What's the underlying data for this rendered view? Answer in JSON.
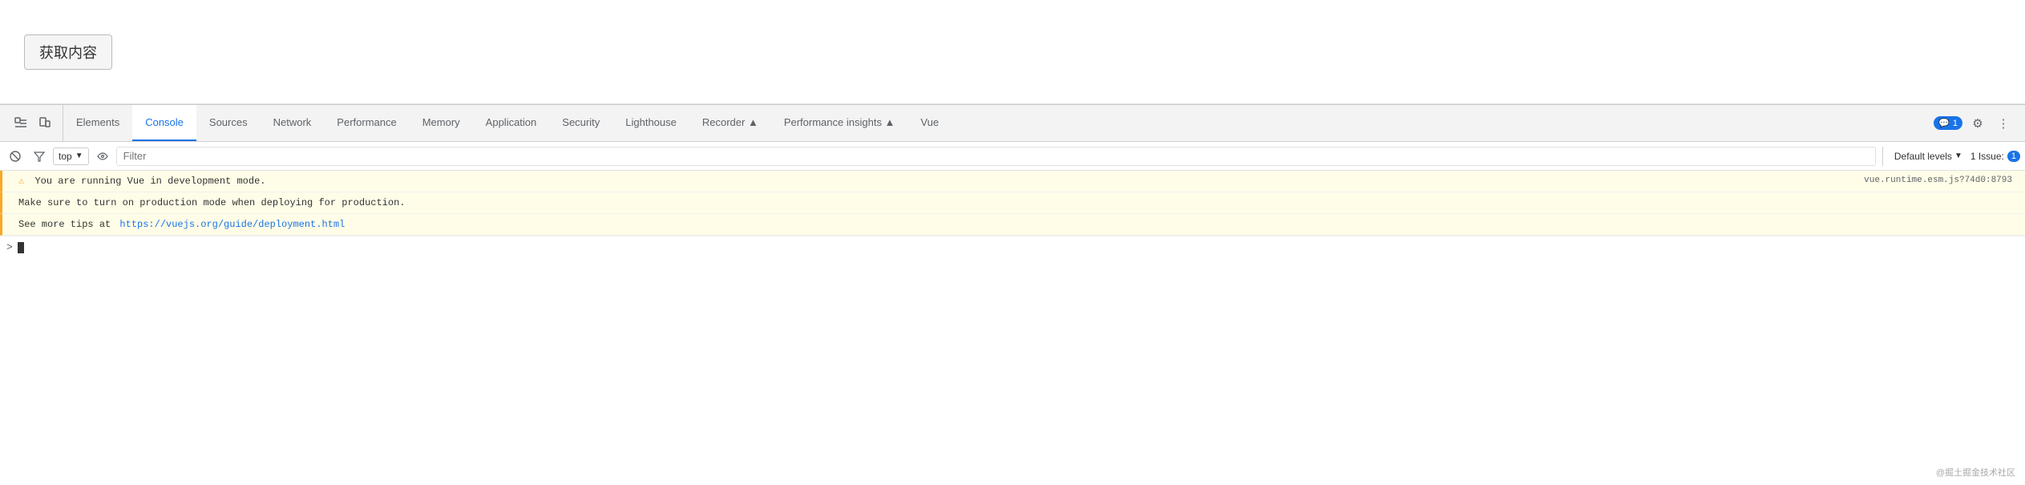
{
  "page": {
    "button_label": "获取内容"
  },
  "devtools": {
    "tabs": [
      {
        "id": "elements",
        "label": "Elements",
        "active": false
      },
      {
        "id": "console",
        "label": "Console",
        "active": true
      },
      {
        "id": "sources",
        "label": "Sources",
        "active": false
      },
      {
        "id": "network",
        "label": "Network",
        "active": false
      },
      {
        "id": "performance",
        "label": "Performance",
        "active": false
      },
      {
        "id": "memory",
        "label": "Memory",
        "active": false
      },
      {
        "id": "application",
        "label": "Application",
        "active": false
      },
      {
        "id": "security",
        "label": "Security",
        "active": false
      },
      {
        "id": "lighthouse",
        "label": "Lighthouse",
        "active": false
      },
      {
        "id": "recorder",
        "label": "Recorder ▲",
        "active": false
      },
      {
        "id": "performance-insights",
        "label": "Performance insights ▲",
        "active": false
      },
      {
        "id": "vue",
        "label": "Vue",
        "active": false
      }
    ],
    "right_badges": {
      "notification_icon": "💬",
      "notification_count": "1",
      "settings_icon": "⚙",
      "more_icon": "⋮"
    },
    "toolbar": {
      "clear_icon": "🚫",
      "top_label": "top",
      "eye_icon": "👁",
      "filter_placeholder": "Filter",
      "default_levels_label": "Default levels",
      "issues_label": "1 Issue:",
      "issues_count": "1"
    },
    "console_messages": [
      {
        "text": "You are running Vue in development mode.",
        "link": null,
        "link_text": null,
        "file_ref": "vue.runtime.esm.js?74d0:8793",
        "type": "warning"
      },
      {
        "text": "Make sure to turn on production mode when deploying for production.",
        "link": null,
        "link_text": null,
        "file_ref": null,
        "type": "warning"
      },
      {
        "text": "See more tips at ",
        "link": "https://vuejs.org/guide/deployment.html",
        "link_text": "https://vuejs.org/guide/deployment.html",
        "file_ref": null,
        "type": "warning"
      }
    ],
    "watermark": "@掘土掘金技术社区"
  }
}
